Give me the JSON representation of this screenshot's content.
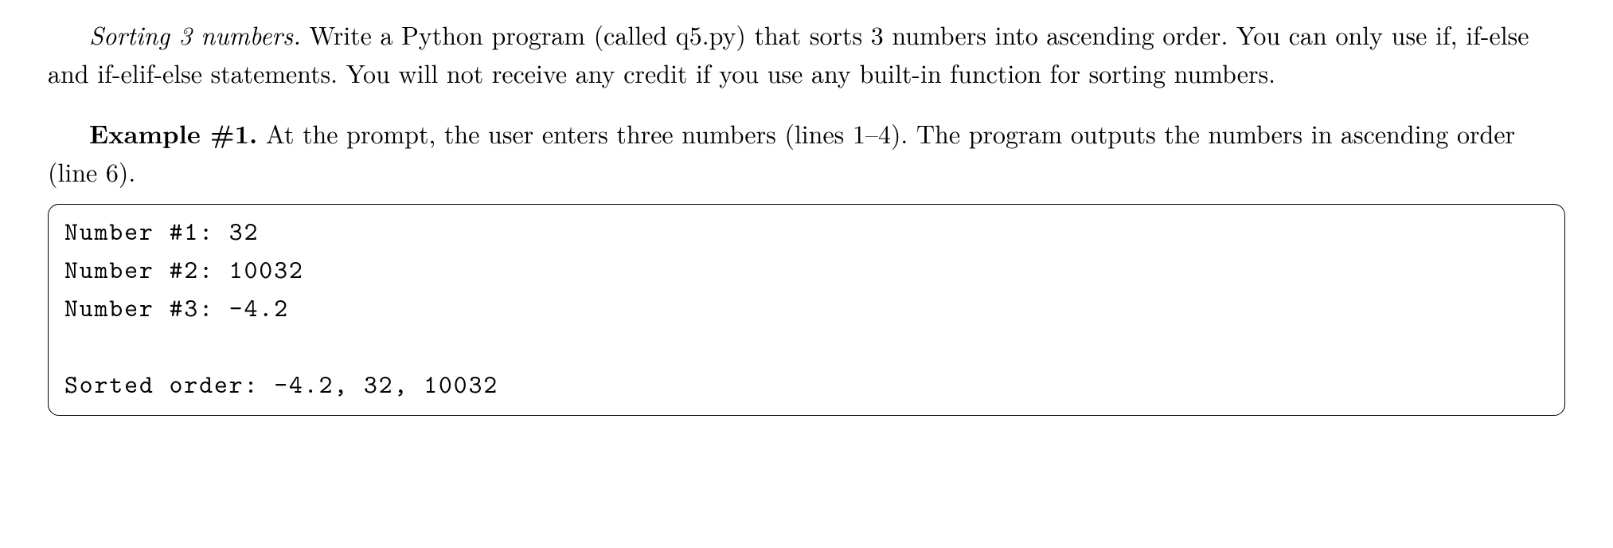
{
  "problem": {
    "title_italic": "Sorting 3 numbers.",
    "description_part1": "  Write a Python program (called q5.py) that sorts 3 numbers into ascending order. You can only use if, if-else and if-elif-else statements. You will not receive any credit if you use any built-in function for sorting numbers."
  },
  "example": {
    "label": "Example #1.",
    "description": "  At the prompt, the user enters three numbers (lines 1–4). The program outputs the numbers in ascending order (line 6)."
  },
  "code": {
    "line1": "Number #1: 32",
    "line2": "Number #2: 10032",
    "line3": "Number #3: -4.2",
    "line4": "Sorted order: -4.2, 32, 10032"
  }
}
